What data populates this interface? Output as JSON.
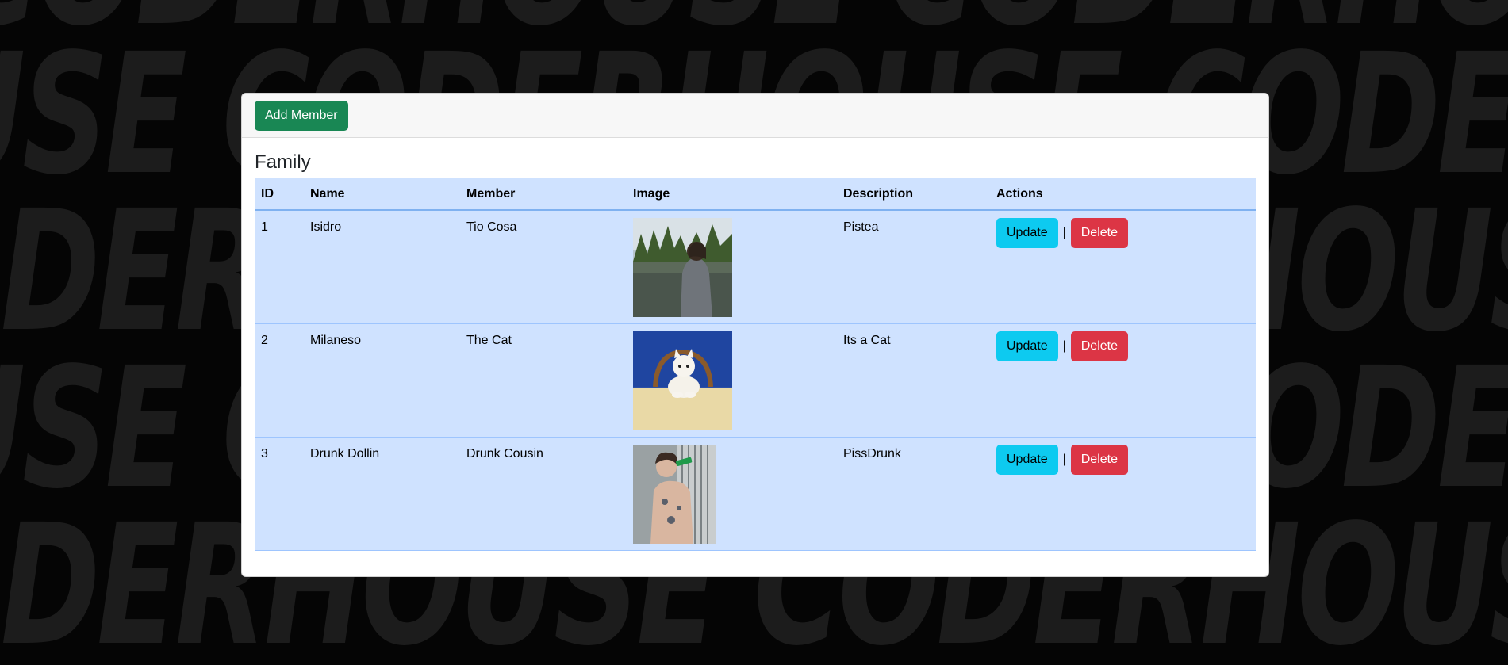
{
  "background": {
    "watermark_text": "CODERHOUSE CODERHOUSE CODERHOUSE CODERHOUSE"
  },
  "toolbar": {
    "add_member_label": "Add Member"
  },
  "section": {
    "title": "Family"
  },
  "table": {
    "headers": [
      "ID",
      "Name",
      "Member",
      "Image",
      "Description",
      "Actions"
    ],
    "rows": [
      {
        "id": "1",
        "name": "Isidro",
        "member": "Tio Cosa",
        "image": "photo-man-by-lake",
        "description": "Pistea",
        "update_label": "Update",
        "separator": "|",
        "delete_label": "Delete"
      },
      {
        "id": "2",
        "name": "Milaneso",
        "member": "The Cat",
        "image": "photo-white-cat-at-table",
        "description": "Its a Cat",
        "update_label": "Update",
        "separator": "|",
        "delete_label": "Delete"
      },
      {
        "id": "3",
        "name": "Drunk Dollin",
        "member": "Drunk Cousin",
        "image": "photo-man-drinking-bottle",
        "description": "PissDrunk",
        "update_label": "Update",
        "separator": "|",
        "delete_label": "Delete"
      }
    ]
  },
  "colors": {
    "add_button": "#198754",
    "update_button": "#0dcaf0",
    "delete_button": "#dc3545",
    "table_row": "#cfe2ff"
  }
}
